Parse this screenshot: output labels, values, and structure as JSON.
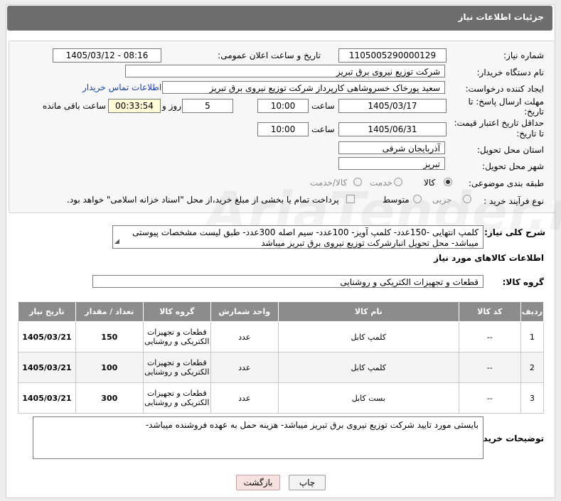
{
  "header": {
    "title": "جزئیات اطلاعات نیاز"
  },
  "form": {
    "need_number_label": "شماره نیاز:",
    "need_number": "1105005290000129",
    "announce_label": "تاریخ و ساعت اعلان عمومی:",
    "announce_value": "1405/03/12 - 08:16",
    "buyer_label": "نام دستگاه خریدار:",
    "buyer_value": "شرکت توزیع نیروی برق تبریز",
    "creator_label": "ایجاد کننده درخواست:",
    "creator_value": "سعید پورخاک خسروشاهی کارپرداز شرکت توزیع نیروی برق تبریز",
    "contact_link": "اطلاعات تماس خریدار",
    "deadline_label_1": "مهلت ارسال پاسخ: تا",
    "deadline_label_2": "تاریخ:",
    "deadline_date": "1405/03/17",
    "time_label": "ساعت",
    "deadline_time": "10:00",
    "days_value": "5",
    "days_label": "روز و",
    "remaining_value": "00:33:54",
    "remaining_label": "ساعت باقی مانده",
    "validity_label_1": "حداقل تاریخ اعتبار قیمت:",
    "validity_label_2": "تا تاریخ:",
    "validity_date": "1405/06/31",
    "validity_time": "10:00",
    "province_label": "استان محل تحویل:",
    "province_value": "آذربایجان شرقی",
    "city_label": "شهر محل تحویل:",
    "city_value": "تبریز",
    "category_label": "طبقه بندی موضوعی:",
    "category_options": [
      "کالا",
      "خدمت",
      "کالا/خدمت"
    ],
    "category_selected": "کالا",
    "process_label": "نوع فرآیند خرید :",
    "process_options": [
      "جزیی",
      "متوسط"
    ],
    "process_selected": "متوسط",
    "payment_note": "پرداخت تمام یا بخشی از مبلغ خرید،از محل \"اسناد خزانه اسلامی\" خواهد بود."
  },
  "summary": {
    "label": "شرح کلی نیاز:",
    "text": "کلمپ انتهایی -150عدد- کلمپ آویز- 100عدد- سیم اصله 300عدد- طبق لیست مشخصات پیوستی میباشد- محل تحویل انبارشرکت توزیع نیروی برق تبریز میباشد"
  },
  "goods_section": {
    "title": "اطلاعات کالاهای مورد نیاز",
    "group_label": "گروه کالا:",
    "group_value": "قطعات و تجهیزات الکتریکی و روشنایی"
  },
  "table": {
    "headers": [
      "ردیف",
      "کد کالا",
      "نام کالا",
      "واحد شمارش",
      "گروه کالا",
      "تعداد / مقدار",
      "تاریخ نیاز"
    ],
    "rows": [
      {
        "row": "1",
        "code": "--",
        "name": "کلمپ کابل",
        "unit": "عدد",
        "group": "قطعات و تجهیزات الکتریکی و روشنایی",
        "qty": "150",
        "date": "1405/03/21"
      },
      {
        "row": "2",
        "code": "--",
        "name": "کلمپ کابل",
        "unit": "عدد",
        "group": "قطعات و تجهیزات الکتریکی و روشنایی",
        "qty": "100",
        "date": "1405/03/21"
      },
      {
        "row": "3",
        "code": "--",
        "name": "بست کابل",
        "unit": "عدد",
        "group": "قطعات و تجهیزات الکتریکی و روشنایی",
        "qty": "300",
        "date": "1405/03/21"
      }
    ]
  },
  "buyer_notes": {
    "label": "توضیحات خریدار:",
    "text": "بایستی مورد تایید شرکت توزیع نیروی برق تبریز میباشد- هزینه حمل به عهده فروشنده میباشد-"
  },
  "buttons": {
    "print": "چاپ",
    "back": "بازگشت"
  },
  "watermark": "AriaTender.net"
}
